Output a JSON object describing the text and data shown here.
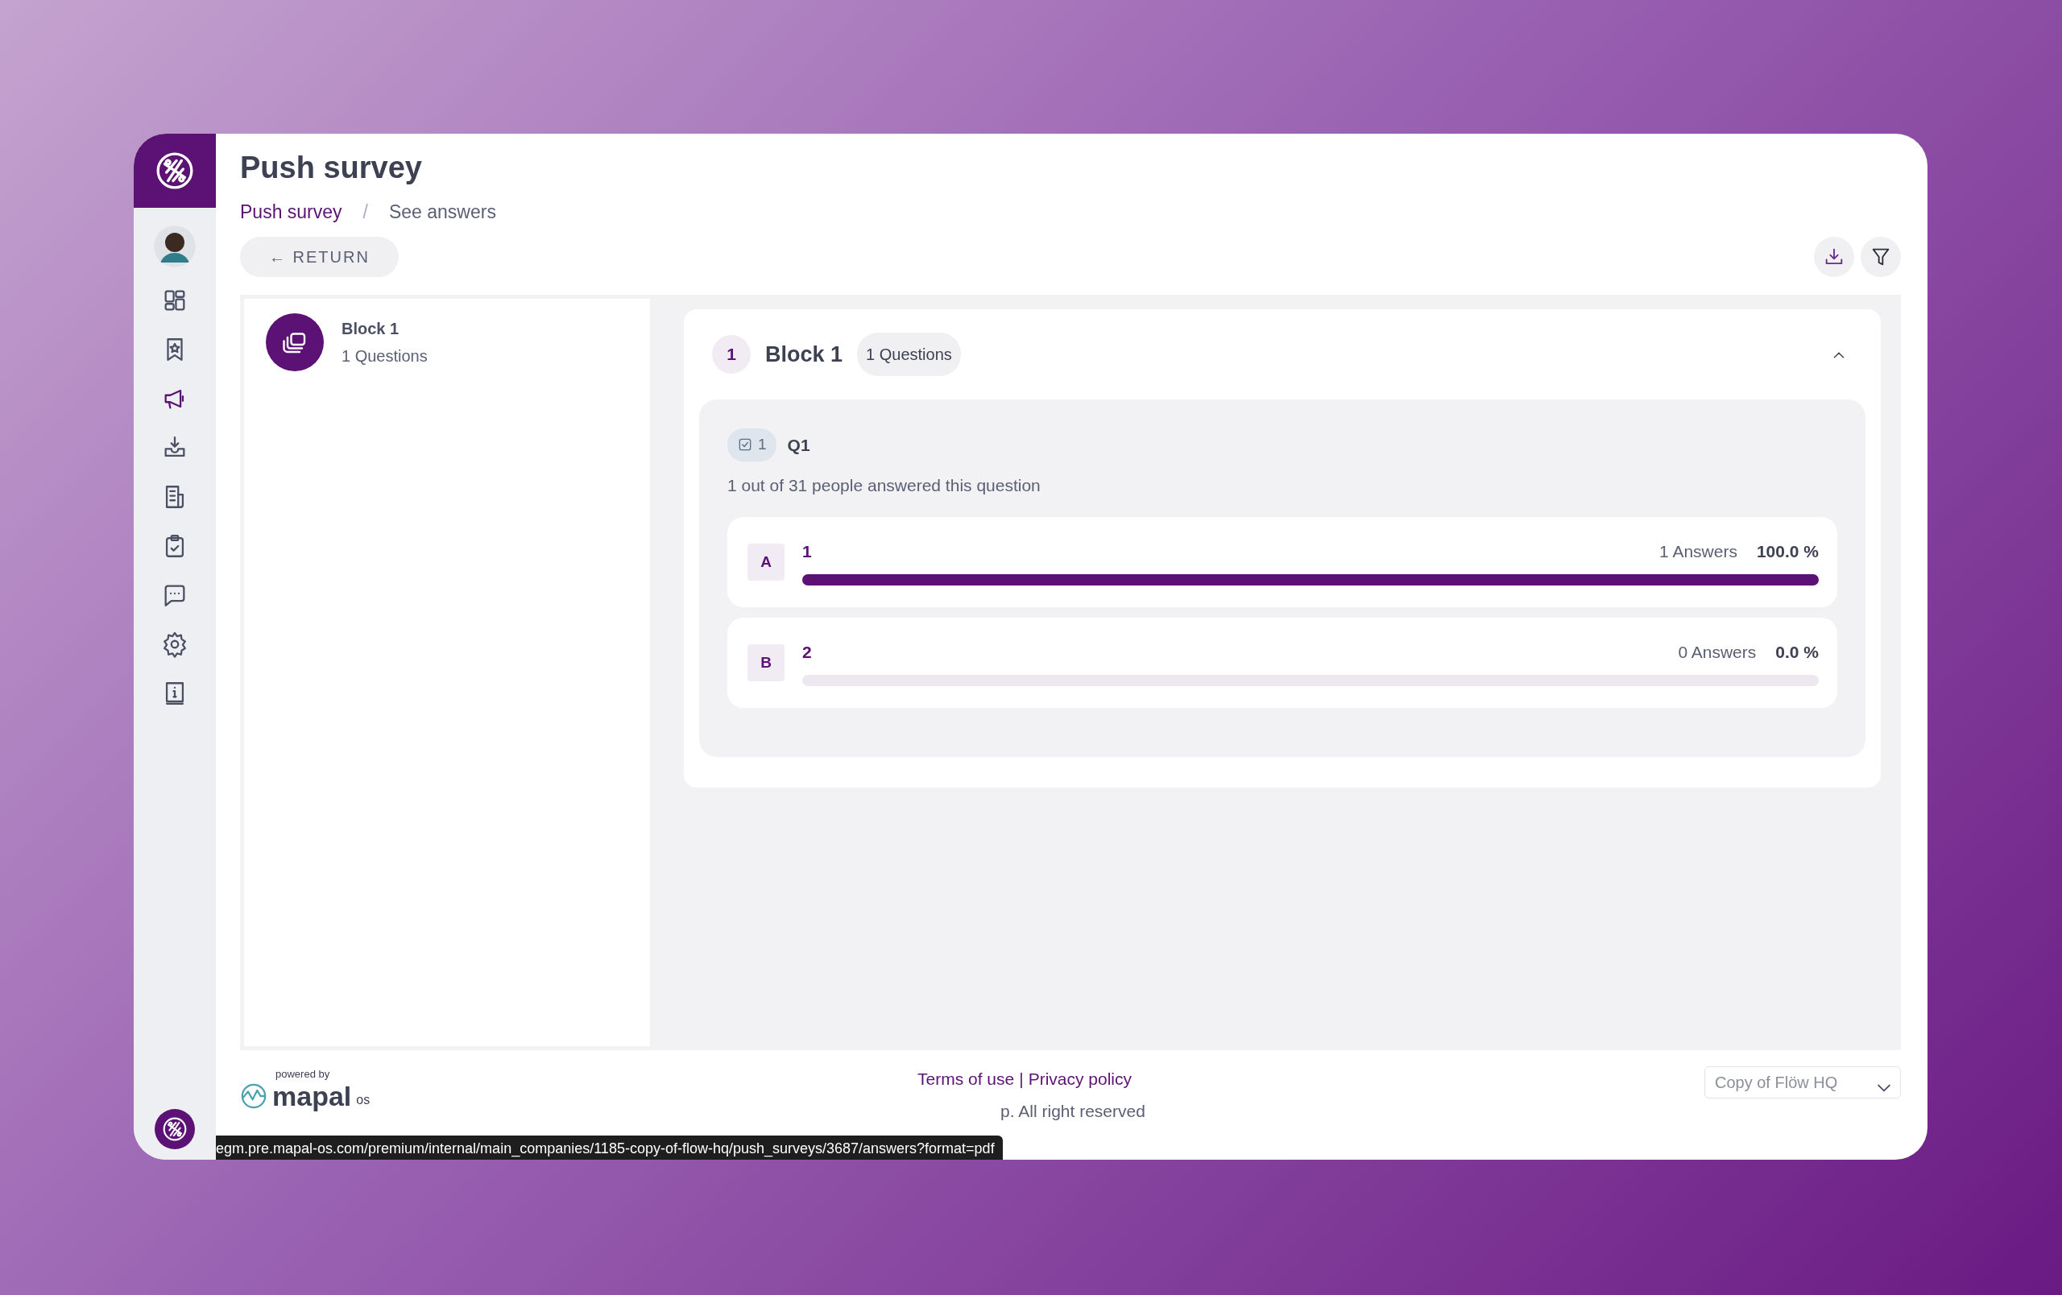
{
  "page": {
    "title": "Push survey"
  },
  "breadcrumb": [
    {
      "label": "Push survey",
      "link": true
    },
    {
      "label": "See answers",
      "link": false
    }
  ],
  "breadcrumb_separator": "/",
  "return_button": {
    "label": "← RETURN"
  },
  "sidebar": {
    "items": [
      {
        "selected": false
      },
      {
        "selected": false
      },
      {
        "selected": true
      },
      {
        "selected": false
      },
      {
        "selected": false
      },
      {
        "selected": false
      },
      {
        "selected": false
      },
      {
        "selected": false
      },
      {
        "selected": false
      }
    ]
  },
  "blocks": [
    {
      "title": "Block 1",
      "subtitle": "1 Questions"
    }
  ],
  "block_panel": {
    "number": "1",
    "title": "Block 1",
    "questions_badge": "1 Questions",
    "expanded": true,
    "questions": [
      {
        "type_count": "1",
        "title": "Q1",
        "summary": "1 out of 31 people answered this question",
        "options": [
          {
            "letter": "A",
            "label": "1",
            "answers": "1 Answers",
            "percent": "100.0 %",
            "level": 1
          },
          {
            "letter": "B",
            "label": "2",
            "answers": "0 Answers",
            "percent": "0.0 %",
            "level": 0
          }
        ]
      }
    ]
  },
  "footer": {
    "powered_by": "powered by",
    "brand": "mapal",
    "brand_suffix": "os",
    "links": [
      "Terms of use",
      "Privacy policy"
    ],
    "link_separator": "|",
    "copyright": "p. All right reserved",
    "company_select": "Copy of Flöw HQ"
  },
  "status_url": "egm.pre.mapal-os.com/premium/internal/main_companies/1185-copy-of-flow-hq/push_surveys/3687/answers?format=pdf"
}
